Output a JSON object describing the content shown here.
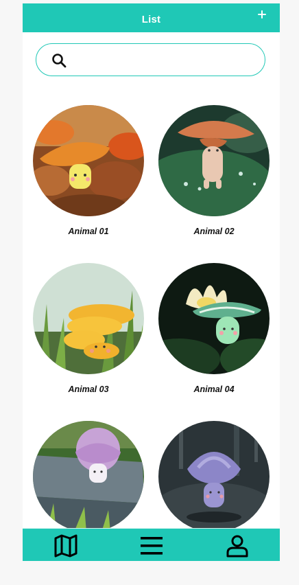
{
  "header": {
    "title": "List",
    "add_icon": "plus-icon"
  },
  "search": {
    "placeholder": "",
    "value": "",
    "icon": "search-icon"
  },
  "animals": [
    {
      "name": "Animal 01",
      "scene": "autumn leaves, orange mushroom"
    },
    {
      "name": "Animal 02",
      "scene": "green leaf with droplets, brown mushroom"
    },
    {
      "name": "Animal 03",
      "scene": "grass, yellow mushroom"
    },
    {
      "name": "Animal 04",
      "scene": "lotus flower, green mushroom"
    },
    {
      "name": "",
      "scene": "stone with grass, pink mushroom"
    },
    {
      "name": "",
      "scene": "dark forest, purple mushroom"
    }
  ],
  "tabbar": {
    "items": [
      {
        "icon": "map-icon"
      },
      {
        "icon": "menu-icon"
      },
      {
        "icon": "user-icon"
      }
    ]
  },
  "colors": {
    "accent": "#1fc8b6",
    "background": "#ffffff",
    "text": "#111111"
  }
}
